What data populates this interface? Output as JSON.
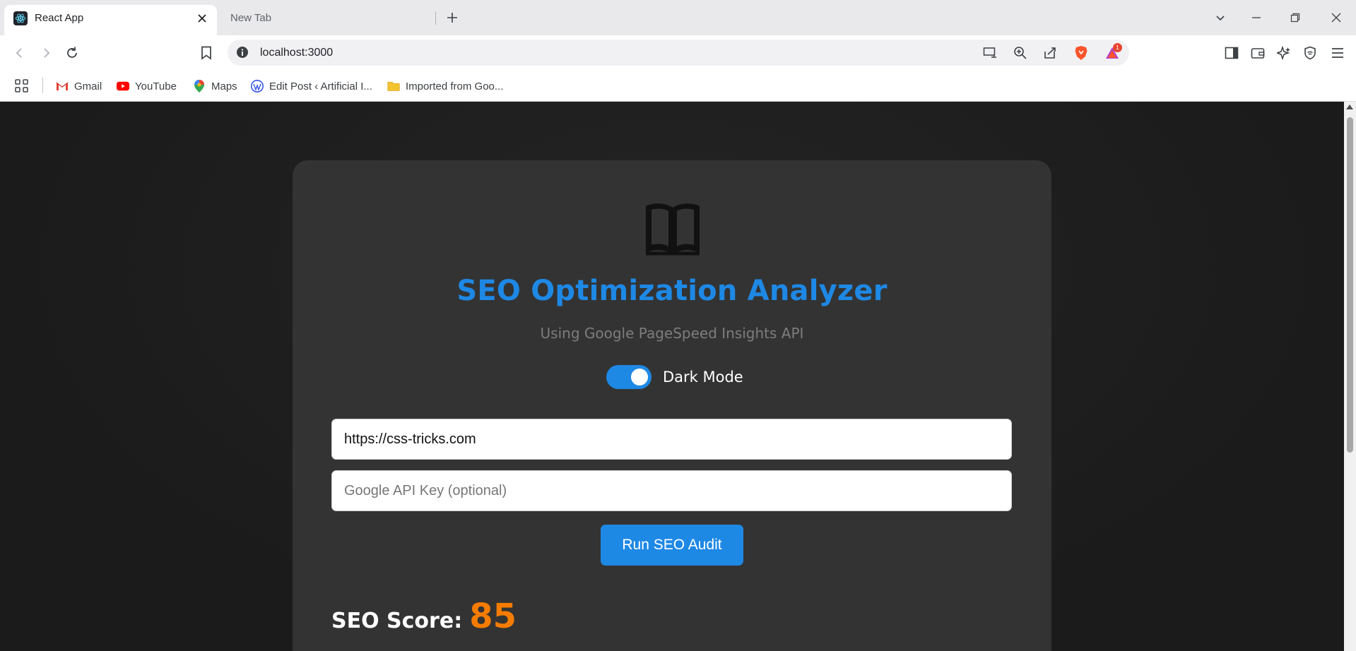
{
  "browser": {
    "tabs": [
      {
        "title": "React App",
        "active": true
      },
      {
        "title": "New Tab",
        "active": false
      }
    ],
    "url": "localhost:3000",
    "extension_badge": "1",
    "bookmarks": [
      {
        "label": "Gmail",
        "icon": "gmail-icon"
      },
      {
        "label": "YouTube",
        "icon": "youtube-icon"
      },
      {
        "label": "Maps",
        "icon": "maps-icon"
      },
      {
        "label": "Edit Post ‹ Artificial I...",
        "icon": "wordpress-icon"
      },
      {
        "label": "Imported from Goo...",
        "icon": "folder-icon"
      }
    ]
  },
  "app": {
    "title": "SEO Optimization Analyzer",
    "subtitle": "Using Google PageSpeed Insights API",
    "dark_mode_label": "Dark Mode",
    "dark_mode_on": true,
    "url_input": {
      "value": "https://css-tricks.com",
      "placeholder": ""
    },
    "api_key_input": {
      "value": "",
      "placeholder": "Google API Key (optional)"
    },
    "run_button": "Run SEO Audit",
    "score_label": "SEO Score:",
    "score_value": "85"
  },
  "colors": {
    "accent": "#1e88e5",
    "score": "#f57c00",
    "card": "#333333",
    "page_bg": "#1e1e1e"
  }
}
